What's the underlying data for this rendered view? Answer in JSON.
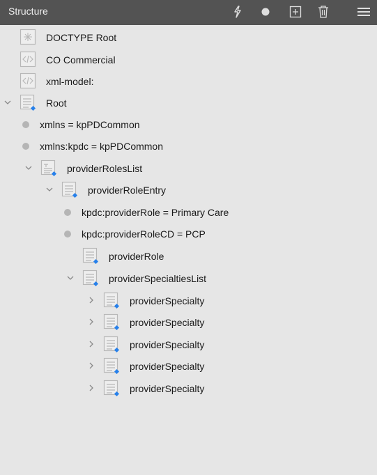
{
  "header": {
    "title": "Structure",
    "icons": [
      "flash-icon",
      "record-dot-icon",
      "add-icon",
      "trash-icon",
      "menu-icon"
    ]
  },
  "tree": {
    "nodes": [
      {
        "label": "DOCTYPE Root",
        "kind": "doctype",
        "depth": 0
      },
      {
        "label": "CO Commercial",
        "kind": "processing-instruction",
        "depth": 0
      },
      {
        "label": "xml-model:",
        "kind": "processing-instruction",
        "depth": 0
      },
      {
        "label": "Root",
        "kind": "element",
        "depth": 0,
        "expanded": true
      },
      {
        "label": "xmlns = kpPDCommon",
        "kind": "attribute",
        "depth": 1
      },
      {
        "label": "xmlns:kpdc = kpPDCommon",
        "kind": "attribute",
        "depth": 1
      },
      {
        "label": "providerRolesList",
        "kind": "element-list",
        "depth": 1,
        "expanded": true
      },
      {
        "label": "providerRoleEntry",
        "kind": "element",
        "depth": 2,
        "expanded": true
      },
      {
        "label": "kpdc:providerRole = Primary Care",
        "kind": "attribute",
        "depth": 3
      },
      {
        "label": "kpdc:providerRoleCD = PCP",
        "kind": "attribute",
        "depth": 3
      },
      {
        "label": "providerRole",
        "kind": "element",
        "depth": 3
      },
      {
        "label": "providerSpecialtiesList",
        "kind": "element",
        "depth": 3,
        "expanded": true
      },
      {
        "label": "providerSpecialty",
        "kind": "element",
        "depth": 4,
        "expanded": false
      },
      {
        "label": "providerSpecialty",
        "kind": "element",
        "depth": 4,
        "expanded": false
      },
      {
        "label": "providerSpecialty",
        "kind": "element",
        "depth": 4,
        "expanded": false
      },
      {
        "label": "providerSpecialty",
        "kind": "element",
        "depth": 4,
        "expanded": false
      },
      {
        "label": "providerSpecialty",
        "kind": "element",
        "depth": 4,
        "expanded": false
      }
    ]
  },
  "colors": {
    "header_bg": "#535353",
    "panel_bg": "#e6e6e6",
    "accent_blue": "#2680eb",
    "icon_gray": "#b8b8b8"
  }
}
